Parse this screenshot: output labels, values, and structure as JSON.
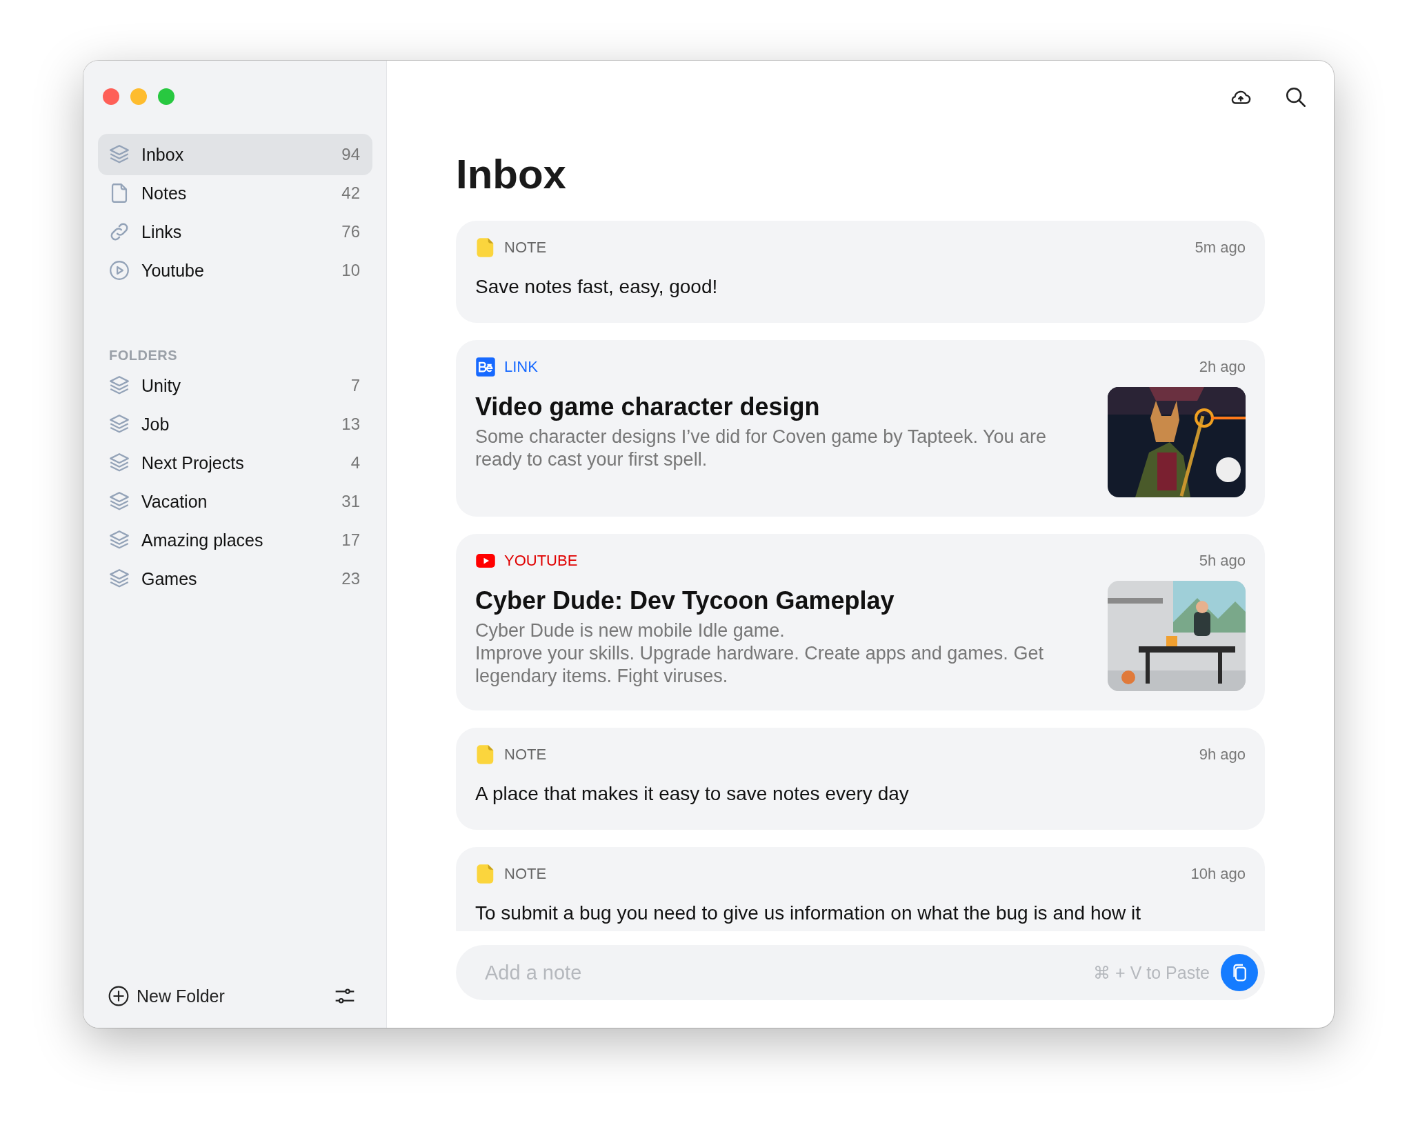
{
  "sidebar": {
    "items": [
      {
        "kind": "stack",
        "label": "Inbox",
        "count": "94",
        "selected": true
      },
      {
        "kind": "note",
        "label": "Notes",
        "count": "42",
        "selected": false
      },
      {
        "kind": "link",
        "label": "Links",
        "count": "76",
        "selected": false
      },
      {
        "kind": "play",
        "label": "Youtube",
        "count": "10",
        "selected": false
      }
    ],
    "folders_heading": "FOLDERS",
    "folders": [
      {
        "kind": "stack",
        "label": "Unity",
        "count": "7",
        "selected": false
      },
      {
        "kind": "stack",
        "label": "Job",
        "count": "13",
        "selected": false
      },
      {
        "kind": "stack",
        "label": "Next Projects",
        "count": "4",
        "selected": false
      },
      {
        "kind": "stack",
        "label": "Vacation",
        "count": "31",
        "selected": false
      },
      {
        "kind": "stack",
        "label": "Amazing places",
        "count": "17",
        "selected": false
      },
      {
        "kind": "stack",
        "label": "Games",
        "count": "23",
        "selected": false
      }
    ],
    "new_folder": "New Folder"
  },
  "title": "Inbox",
  "cards": [
    {
      "kind": "note",
      "tag": "NOTE",
      "time": "5m ago",
      "text": "Save notes fast, easy, good!"
    },
    {
      "kind": "link",
      "tag": "LINK",
      "time": "2h ago",
      "title": "Video game character design",
      "description": [
        "Some character designs I’ve did for Coven game by Tapteek. You are ready to cast your first spell."
      ],
      "picture": {
        "kind": "picture"
      }
    },
    {
      "kind": "youtube",
      "tag": "YOUTUBE",
      "time": "5h ago",
      "title": "Cyber Dude: Dev Tycoon Gameplay",
      "description": [
        "Cyber Dude is new mobile Idle game.",
        "Improve your skills. Upgrade hardware. Create apps and games. Get legendary items. Fight viruses."
      ],
      "picture": {
        "kind": "picture"
      }
    },
    {
      "kind": "note",
      "tag": "NOTE",
      "time": "9h ago",
      "text": "A place that makes it easy to save notes every day"
    },
    {
      "kind": "note",
      "tag": "NOTE",
      "time": "10h ago",
      "text": "To submit a bug you need to give us information on what the bug is and how it"
    }
  ],
  "composer": {
    "placeholder": "Add a note",
    "hint": "⌘ + V to Paste"
  }
}
